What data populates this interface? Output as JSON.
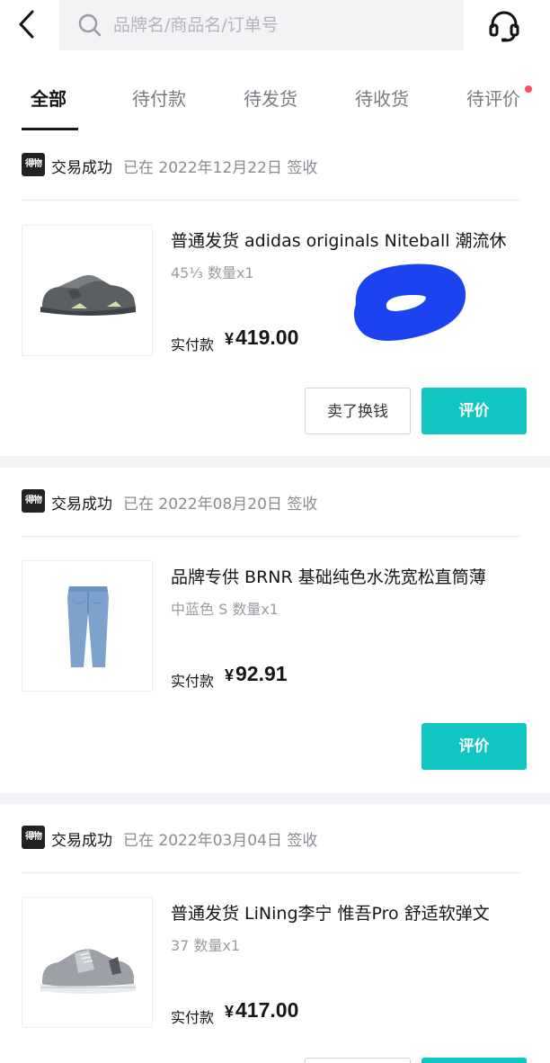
{
  "search": {
    "placeholder": "品牌名/商品名/订单号"
  },
  "tabs": [
    {
      "label": "全部",
      "active": true
    },
    {
      "label": "待付款"
    },
    {
      "label": "待发货"
    },
    {
      "label": "待收货"
    },
    {
      "label": "待评价",
      "has_dot": true
    }
  ],
  "colors": {
    "accent": "#0fc6c2",
    "dot": "#ff4d5f",
    "scribble": "#1b44f0"
  },
  "orders": [
    {
      "brand_badge": "得物",
      "status": "交易成功",
      "date_text": "已在 2022年12月22日 签收",
      "product_name": "普通发货 adidas originals Niteball 潮流休",
      "spec": "45⅓ 数量x1",
      "price_label": "实付款",
      "currency": "¥",
      "price": "419.00",
      "buttons": {
        "secondary": "卖了换钱",
        "primary": "评价"
      },
      "image": "grey-sneaker"
    },
    {
      "brand_badge": "得物",
      "status": "交易成功",
      "date_text": "已在 2022年08月20日 签收",
      "product_name": "品牌专供 BRNR 基础纯色水洗宽松直筒薄",
      "spec": "中蓝色 S 数量x1",
      "price_label": "实付款",
      "currency": "¥",
      "price": "92.91",
      "buttons": {
        "primary": "评价"
      },
      "image": "blue-jeans"
    },
    {
      "brand_badge": "得物",
      "status": "交易成功",
      "date_text": "已在 2022年03月04日 签收",
      "product_name": "普通发货 LiNing李宁 惟吾Pro 舒适软弹文",
      "spec": "37 数量x1",
      "price_label": "实付款",
      "currency": "¥",
      "price": "417.00",
      "buttons": {
        "secondary": "",
        "primary": ""
      },
      "image": "grey-skate-shoe"
    }
  ]
}
